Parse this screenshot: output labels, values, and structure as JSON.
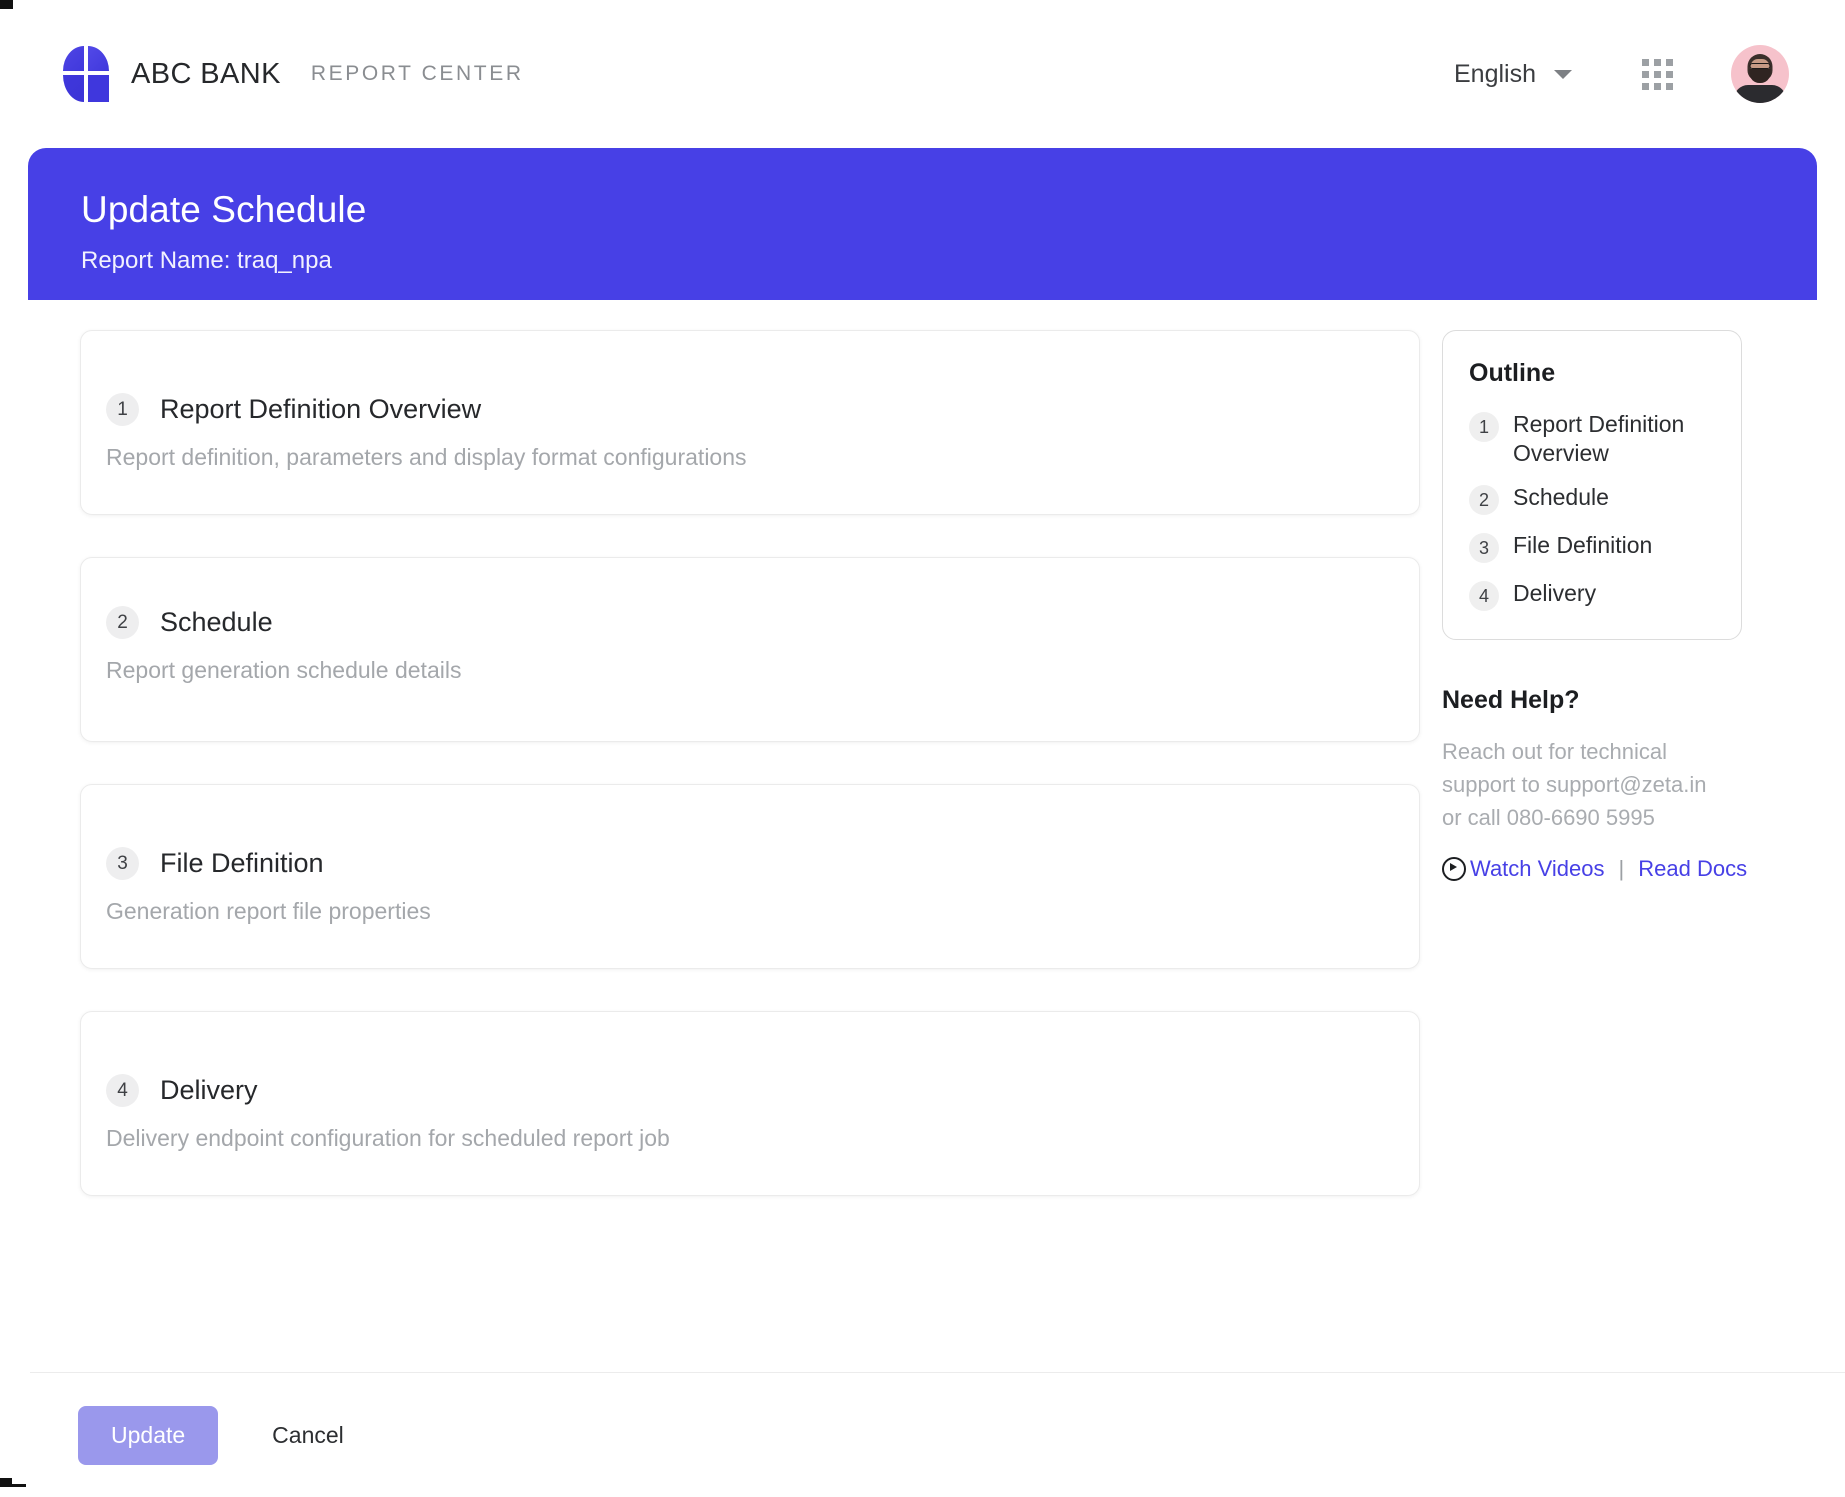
{
  "topbar": {
    "brand_name": "ABC BANK",
    "brand_sub": "REPORT CENTER",
    "logo_icon": "abc-bank-quadrant-logo",
    "language": "English",
    "language_caret_icon": "chevron-down-icon",
    "apps_icon": "apps-grid-icon",
    "avatar_icon": "user-avatar"
  },
  "hero": {
    "title": "Update Schedule",
    "subtitle": "Report Name: traq_npa",
    "accent_color": "#4740e6"
  },
  "sections": [
    {
      "number": "1",
      "title": "Report Definition Overview",
      "desc": "Report definition, parameters and display format configurations"
    },
    {
      "number": "2",
      "title": "Schedule",
      "desc": "Report generation schedule details"
    },
    {
      "number": "3",
      "title": "File Definition",
      "desc": "Generation report file properties"
    },
    {
      "number": "4",
      "title": "Delivery",
      "desc": "Delivery endpoint configuration for scheduled report job"
    }
  ],
  "outline": {
    "title": "Outline",
    "items": [
      {
        "number": "1",
        "label": "Report Definition Overview"
      },
      {
        "number": "2",
        "label": "Schedule"
      },
      {
        "number": "3",
        "label": "File Definition"
      },
      {
        "number": "4",
        "label": "Delivery"
      }
    ]
  },
  "help": {
    "title": "Need Help?",
    "text": "Reach out for technical support to support@zeta.in or call 080-6690 5995",
    "play_icon": "play-circle-icon",
    "watch_videos": "Watch Videos",
    "separator": "|",
    "read_docs": "Read Docs",
    "link_color": "#4740e6"
  },
  "footer": {
    "update_label": "Update",
    "cancel_label": "Cancel",
    "update_color": "#9a98ec"
  }
}
